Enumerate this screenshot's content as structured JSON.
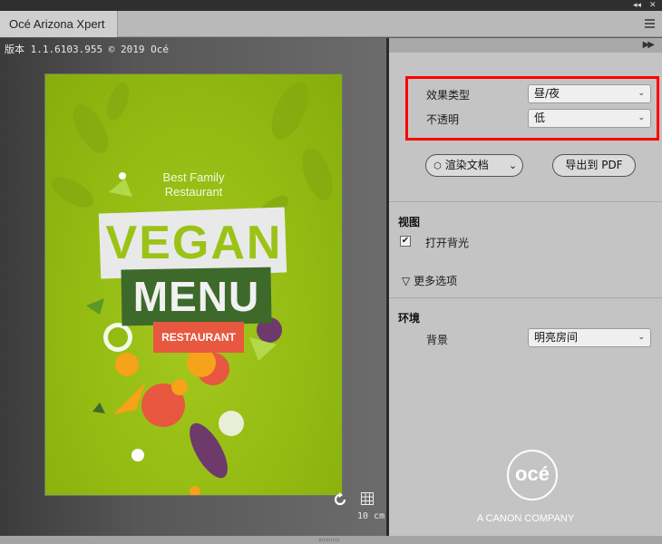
{
  "window": {
    "collapse_glyph": "◂◂",
    "close_glyph": "✕",
    "tab_title": "Océ Arizona Xpert"
  },
  "viewer": {
    "version_text": "版本 1.1.6103.955 © 2019 Océ",
    "poster": {
      "tagline_line1": "Best Family",
      "tagline_line2": "Restaurant",
      "headline": "VEGAN",
      "subheadline": "MENU",
      "badge": "RESTAURANT"
    },
    "scale_text": "10 cm"
  },
  "panel": {
    "expand_glyph": "▶▶",
    "effect": {
      "type_label": "效果类型",
      "type_value": "昼/夜",
      "opacity_label": "不透明",
      "opacity_value": "低"
    },
    "render_button": "渲染文档",
    "export_button": "导出到 PDF",
    "view": {
      "title": "视图",
      "backlight_label": "打开背光",
      "backlight_checked": "✔",
      "more_options": "更多选项",
      "more_glyph": "▽"
    },
    "environment": {
      "title": "环境",
      "background_label": "背景",
      "background_value": "明亮房间"
    },
    "brand": {
      "logo_text": "océ",
      "tagline": "A CANON COMPANY"
    }
  },
  "colors": {
    "highlight_border": "#ff0000",
    "poster_green": "#93bb12",
    "menu_green": "#3d6a2b",
    "badge_red": "#e8573f"
  }
}
